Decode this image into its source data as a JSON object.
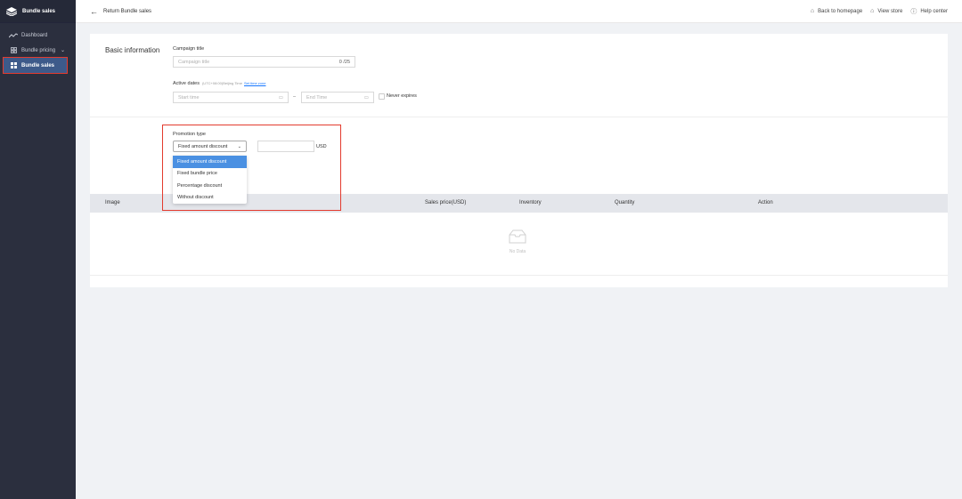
{
  "sidebar": {
    "brand": "Bundle sales",
    "items": [
      {
        "label": "Dashboard",
        "icon": "trend-icon"
      },
      {
        "label": "Bundle pricing",
        "icon": "grid-icon"
      },
      {
        "label": "Bundle sales",
        "icon": "apps-icon"
      }
    ]
  },
  "topbar": {
    "back_label": "Return Bundle sales",
    "links": [
      "Back to homepage",
      "View store",
      "Help center"
    ]
  },
  "form": {
    "section_title": "Basic information",
    "campaign_title_label": "Campaign title",
    "campaign_title_placeholder": "Campaign title",
    "campaign_title_counter": "0 /25",
    "active_dates_label": "Active dates",
    "timezone_text": "(UTC+08:00)Beijing Time",
    "set_timezone_link": "Set time zone",
    "start_placeholder": "Start time",
    "separator": "–",
    "end_placeholder": "End Time",
    "never_expires_label": "Never expires",
    "promotion_type_label": "Promotion type",
    "promotion_selected": "Fixed amount discount",
    "promotion_options": [
      "Fixed amount discount",
      "Fixed bundle price",
      "Percentage discount",
      "Without discount"
    ],
    "amount_value": "",
    "currency": "USD"
  },
  "table": {
    "headers": [
      "Image",
      "Sales price(USD)",
      "Inventory",
      "Quantity",
      "Action"
    ],
    "empty_text": "No Data"
  },
  "colors": {
    "sidebar_bg": "#2b2f3e",
    "active_item": "#3d5a8a",
    "highlight": "#e33b2e",
    "link": "#1677ff"
  }
}
